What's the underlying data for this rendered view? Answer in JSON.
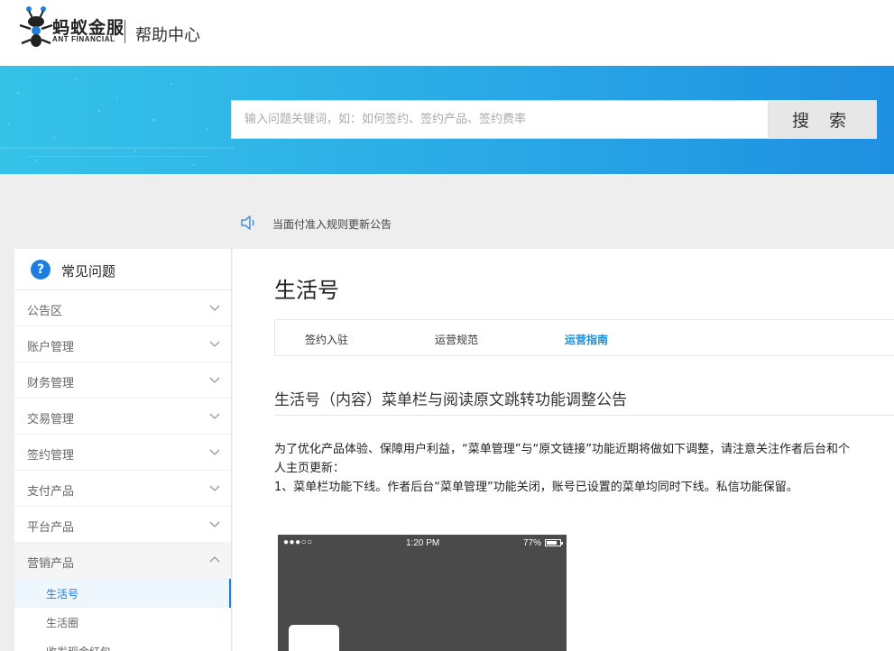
{
  "header": {
    "brand_cn": "蚂蚁金服",
    "brand_en": "ANT FINANCIAL",
    "help_title": "帮助中心"
  },
  "search": {
    "placeholder": "输入问题关键词，如：如何签约、签约产品、签约费率",
    "button_label": "搜 索"
  },
  "notice": {
    "text": "当面付准入规则更新公告"
  },
  "sidebar": {
    "title": "常见问题",
    "items": [
      {
        "label": "公告区"
      },
      {
        "label": "账户管理"
      },
      {
        "label": "财务管理"
      },
      {
        "label": "交易管理"
      },
      {
        "label": "签约管理"
      },
      {
        "label": "支付产品"
      },
      {
        "label": "平台产品"
      },
      {
        "label": "营销产品"
      }
    ],
    "subitems": [
      {
        "label": "生活号"
      },
      {
        "label": "生活圈"
      },
      {
        "label": "收发现金红包"
      }
    ]
  },
  "main": {
    "page_title": "生活号",
    "tabs": [
      {
        "label": "签约入驻"
      },
      {
        "label": "运营规范"
      },
      {
        "label": "运营指南"
      }
    ],
    "article_title": "生活号（内容）菜单栏与阅读原文跳转功能调整公告",
    "paragraph1": "为了优化产品体验、保障用户利益，“菜单管理”与“原文链接”功能近期将做如下调整，请注意关注作者后台和个人主页更新：",
    "paragraph2": "1、菜单栏功能下线。作者后台“菜单管理”功能关闭，账号已设置的菜单均同时下线。私信功能保留。"
  },
  "phone": {
    "signal": "●●●○○",
    "time": "1:20 PM",
    "battery": "77%"
  },
  "colors": {
    "accent": "#1d7ee0",
    "active_tab": "#1d8fd8",
    "banner_start": "#35c3e8",
    "banner_end": "#1f8fe0"
  }
}
